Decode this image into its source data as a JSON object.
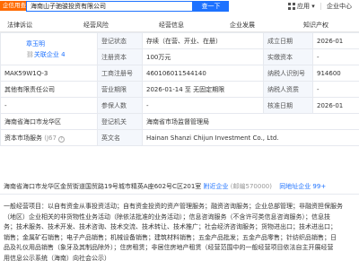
{
  "topbar": {
    "badge": "企信用查询",
    "search_value": "海南山子驰骏投资有限公司",
    "search_button": "查一下",
    "app_label": "应用",
    "app_icon": "grid-icon",
    "center_label": "企业中心"
  },
  "tabs": [
    "法律诉讼",
    "经营风险",
    "经营信息",
    "企业发展",
    "知识产权"
  ],
  "info": {
    "legal_rep_name": "章玉明",
    "related_label": "关联企业 4",
    "reg_status_label": "登记状态",
    "reg_status_value": "存续（在营、开业、在册）",
    "founded_label": "成立日期",
    "founded_value": "2026-01",
    "reg_capital_label": "注册资本",
    "reg_capital_value": "100万元",
    "paid_capital_label": "实缴资本",
    "paid_capital_value": "-",
    "credit_code": "MAK59W1Q-3",
    "reg_no_label": "工商注册号",
    "reg_no_value": "460106011544140",
    "taxpayer_id_label": "纳税人识别号",
    "taxpayer_id_value": "914600",
    "company_type": "其他有限责任公司",
    "period_label": "营业期限",
    "period_value": "2026-01-14 至 无固定期限",
    "taxpayer_qual_label": "纳税人资质",
    "taxpayer_qual_value": "-",
    "insured_dash": "-",
    "insured_label": "参保人数",
    "insured_value": "-",
    "approved_label": "核准日期",
    "approved_value": "2026-01",
    "region": "海南省海口市龙华区",
    "authority_label": "登记机关",
    "authority_value": "海南省市场监督管理局",
    "industry_label": "资本市场服务",
    "industry_code": "(J67",
    "english_label": "英文名",
    "english_value": "Hainan Shanzi Chijun Investment Co., Ltd."
  },
  "address": {
    "text": "海南省海口市龙华区金贸街道国贸路19号城市精英A座602号C区201室",
    "map_link": "附近企业",
    "count": "(邮编570000)",
    "nearby_link": "同地址企业 99+"
  },
  "scope_lines": [
    "一般经营项目：以自有资金从事投资活动；自有资金投资的资产管理服务；融资咨询服务；企业总部管理；非融资担保服务",
    "（地区）企业相关的非货物性业务活动（除依法批准的业务活动）；信息咨询服务（不含许可类信息咨询服务）；信息技",
    "务；技术服务、技术开发、技术咨询、技术交流、技术转让、技术推广；社会经济咨询服务；货物进出口；技术进出口；",
    "销售；金属矿石销售；电子产品销售；机械设备销售；建筑材料销售；五金产品批发；五金产品零售；针纺织品销售；日",
    "品及礼仪用品销售（象牙及其制品除外）；住房租赁；非居住房地产租赁（经营范围中的一般经营项目依法自主开展经营",
    "用信息公示系统（海南）向社会公示）"
  ],
  "colors": {
    "accent": "#1e72ff",
    "orange": "#ff6a00",
    "label_bg": "#f4f7fc"
  }
}
